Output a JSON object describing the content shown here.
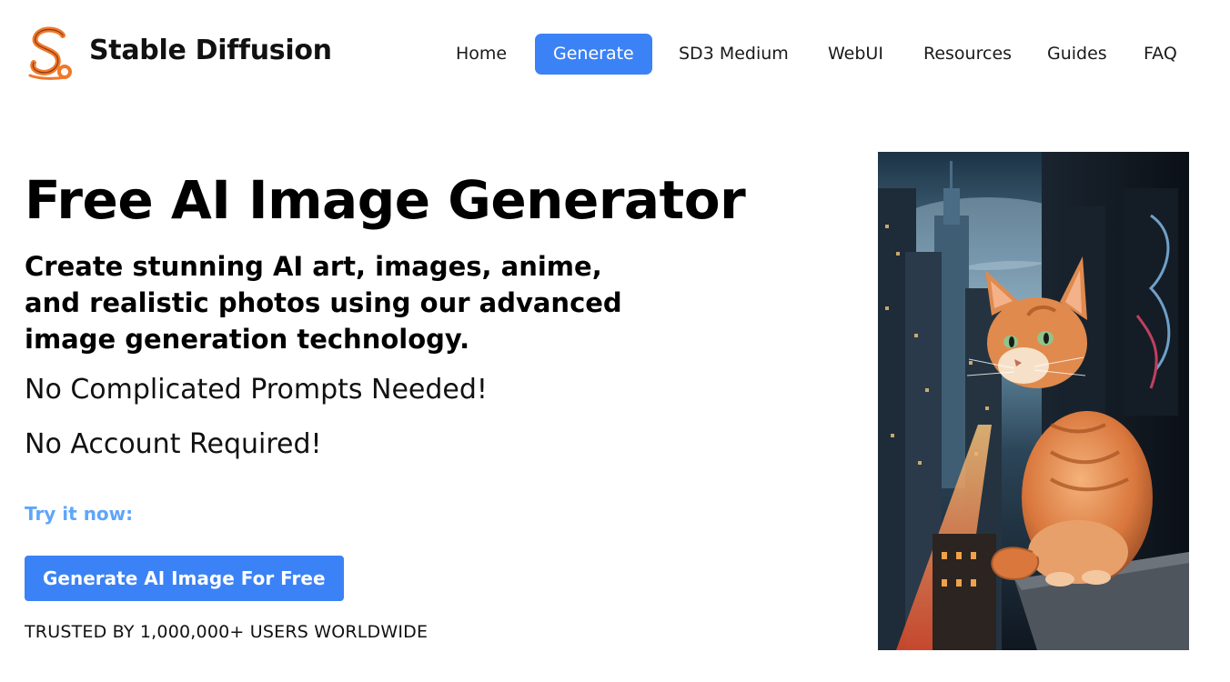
{
  "header": {
    "brand": "Stable Diffusion",
    "logo_icon": "stylized-s-logo-icon",
    "nav": [
      {
        "label": "Home",
        "active": false
      },
      {
        "label": "Generate",
        "active": true
      },
      {
        "label": "SD3 Medium",
        "active": false
      },
      {
        "label": "WebUI",
        "active": false
      },
      {
        "label": "Resources",
        "active": false
      },
      {
        "label": "Guides",
        "active": false
      },
      {
        "label": "FAQ",
        "active": false
      }
    ]
  },
  "hero": {
    "title": "Free AI Image Generator",
    "subtitle": "Create stunning AI art, images, anime, and realistic photos using our advanced image generation technology.",
    "point1": "No Complicated Prompts Needed!",
    "point2": "No Account Required!",
    "try_label": "Try it now:",
    "cta_label": "Generate AI Image For Free",
    "trusted": "TRUSTED BY 1,000,000+ USERS WORLDWIDE"
  },
  "colors": {
    "accent": "#3b82f6",
    "try_text": "#60a5fa",
    "logo_orange": "#f0782a"
  }
}
